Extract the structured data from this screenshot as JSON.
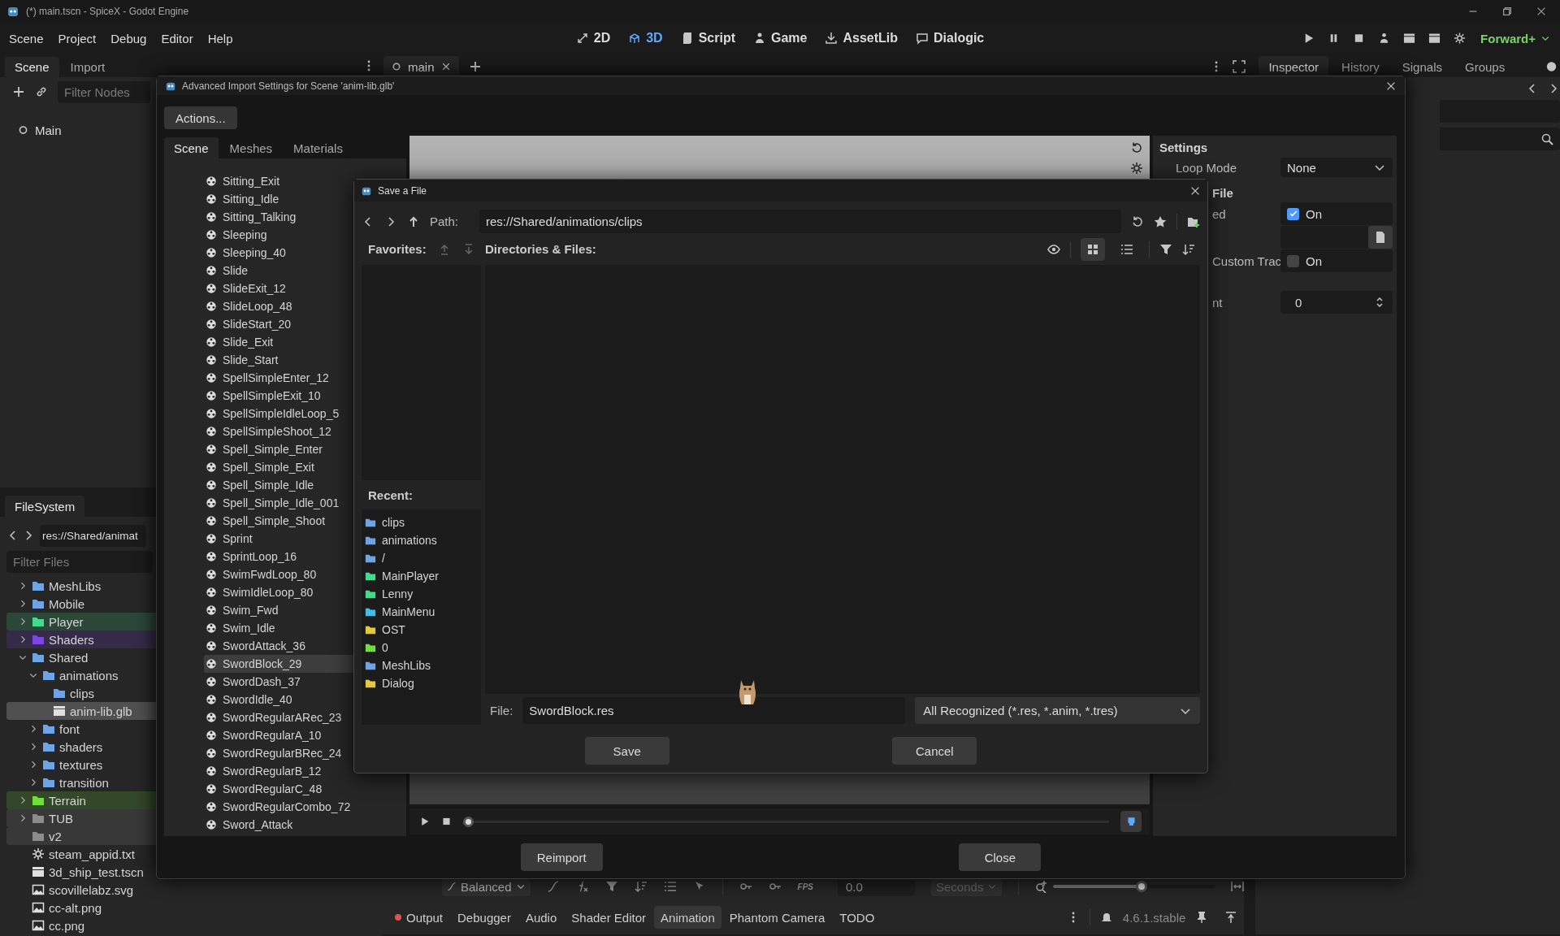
{
  "title_bar": {
    "title": "(*) main.tscn - SpiceX - Godot Engine"
  },
  "menu": [
    "Scene",
    "Project",
    "Debug",
    "Editor",
    "Help"
  ],
  "workspaces": [
    {
      "kind": "twod",
      "label": "2D",
      "selected": false
    },
    {
      "kind": "threed",
      "label": "3D",
      "selected": true
    },
    {
      "kind": "script",
      "label": "Script",
      "selected": false
    },
    {
      "kind": "game",
      "label": "Game",
      "selected": false
    },
    {
      "kind": "assetlib",
      "label": "AssetLib",
      "selected": false
    },
    {
      "kind": "dialogic",
      "label": "Dialogic",
      "selected": false
    }
  ],
  "renderer": "Forward+",
  "scene_dock": {
    "tabs": [
      {
        "label": "Scene",
        "selected": true
      },
      {
        "label": "Import",
        "selected": false
      }
    ],
    "filter_placeholder": "Filter Nodes",
    "nodes": [
      {
        "label": "Main"
      }
    ]
  },
  "filesystem": {
    "tabs": [
      {
        "label": "FileSystem",
        "selected": true
      }
    ],
    "path": "res://Shared/animat",
    "filter_placeholder": "Filter Files",
    "tree": [
      {
        "kind": "folder",
        "label": "MeshLibs",
        "expanded": false,
        "selected": false
      },
      {
        "kind": "folder",
        "label": "Mobile",
        "expanded": false,
        "selected": false
      },
      {
        "kind": "folder",
        "label": "Player",
        "color": "#42dc8c",
        "expanded": false,
        "selected": false
      },
      {
        "kind": "folder",
        "label": "Shaders",
        "color": "#7b45e8",
        "expanded": false,
        "selected": false
      },
      {
        "kind": "folder",
        "label": "Shared",
        "expanded": true,
        "selected": false,
        "children": [
          {
            "kind": "folder",
            "label": "animations",
            "expanded": true,
            "selected": false,
            "children": [
              {
                "kind": "leaf_folder",
                "label": "clips",
                "selected": false
              },
              {
                "kind": "scene",
                "label": "anim-lib.glb",
                "selected": true
              }
            ]
          },
          {
            "kind": "folder",
            "label": "font",
            "expanded": false,
            "selected": false
          },
          {
            "kind": "folder",
            "label": "shaders",
            "expanded": false,
            "selected": false
          },
          {
            "kind": "folder",
            "label": "textures",
            "expanded": false,
            "selected": false
          },
          {
            "kind": "folder",
            "label": "transition",
            "expanded": false,
            "selected": false
          }
        ]
      },
      {
        "kind": "folder",
        "label": "Terrain",
        "color": "#6fe03a",
        "expanded": false,
        "selected": false
      },
      {
        "kind": "folder",
        "label": "TUB",
        "color": "#8c8c8c",
        "expanded": false,
        "selected": false
      },
      {
        "kind": "leaf_folder",
        "label": "v2",
        "color": "#8c8c8c",
        "selected": false
      },
      {
        "kind": "text",
        "label": "steam_appid.txt",
        "selected": false
      },
      {
        "kind": "scene",
        "label": "3d_ship_test.tscn",
        "selected": false
      },
      {
        "kind": "image",
        "label": "scovillelabz.svg",
        "selected": false
      },
      {
        "kind": "image",
        "label": "cc-alt.png",
        "selected": false
      },
      {
        "kind": "image",
        "label": "cc.png",
        "selected": false
      }
    ]
  },
  "scene_tabs": [
    {
      "label": "main",
      "selected": true
    }
  ],
  "inspector_tabs": [
    {
      "label": "Inspector",
      "selected": true
    },
    {
      "label": "History",
      "selected": false
    },
    {
      "label": "Signals",
      "selected": false
    },
    {
      "label": "Groups",
      "selected": false
    }
  ],
  "bottom_panel": {
    "blend": "Balanced",
    "fps_label": "FPS",
    "time": "0.0",
    "unit": {
      "label": "Seconds",
      "disabled": true
    },
    "zoom": {
      "level": 0.55
    },
    "tabs": [
      {
        "label": "Output",
        "selected": false,
        "color": "#e05252"
      },
      {
        "label": "Debugger",
        "selected": false
      },
      {
        "label": "Audio",
        "selected": false
      },
      {
        "label": "Shader Editor",
        "selected": false
      },
      {
        "label": "Animation",
        "selected": true
      },
      {
        "label": "Phantom Camera",
        "selected": false
      },
      {
        "label": "TODO",
        "selected": false
      }
    ],
    "version": "4.6.1.stable"
  },
  "import_dialog": {
    "title": "Advanced Import Settings for Scene 'anim-lib.glb'",
    "actions": "Actions...",
    "tabs": [
      {
        "label": "Scene",
        "selected": true
      },
      {
        "label": "Meshes",
        "selected": false
      },
      {
        "label": "Materials",
        "selected": false
      }
    ],
    "animations": [
      {
        "label": "Sitting_Exit",
        "selected": false
      },
      {
        "label": "Sitting_Idle",
        "selected": false
      },
      {
        "label": "Sitting_Talking",
        "selected": false
      },
      {
        "label": "Sleeping",
        "selected": false
      },
      {
        "label": "Sleeping_40",
        "selected": false
      },
      {
        "label": "Slide",
        "selected": false
      },
      {
        "label": "SlideExit_12",
        "selected": false
      },
      {
        "label": "SlideLoop_48",
        "selected": false
      },
      {
        "label": "SlideStart_20",
        "selected": false
      },
      {
        "label": "Slide_Exit",
        "selected": false
      },
      {
        "label": "Slide_Start",
        "selected": false
      },
      {
        "label": "SpellSimpleEnter_12",
        "selected": false
      },
      {
        "label": "SpellSimpleExit_10",
        "selected": false
      },
      {
        "label": "SpellSimpleIdleLoop_5",
        "selected": false
      },
      {
        "label": "SpellSimpleShoot_12",
        "selected": false
      },
      {
        "label": "Spell_Simple_Enter",
        "selected": false
      },
      {
        "label": "Spell_Simple_Exit",
        "selected": false
      },
      {
        "label": "Spell_Simple_Idle",
        "selected": false
      },
      {
        "label": "Spell_Simple_Idle_001",
        "selected": false
      },
      {
        "label": "Spell_Simple_Shoot",
        "selected": false
      },
      {
        "label": "Sprint",
        "selected": false
      },
      {
        "label": "SprintLoop_16",
        "selected": false
      },
      {
        "label": "SwimFwdLoop_80",
        "selected": false
      },
      {
        "label": "SwimIdleLoop_80",
        "selected": false
      },
      {
        "label": "Swim_Fwd",
        "selected": false
      },
      {
        "label": "Swim_Idle",
        "selected": false
      },
      {
        "label": "SwordAttack_36",
        "selected": false
      },
      {
        "label": "SwordBlock_29",
        "selected": true
      },
      {
        "label": "SwordDash_37",
        "selected": false
      },
      {
        "label": "SwordIdle_40",
        "selected": false
      },
      {
        "label": "SwordRegularARec_23",
        "selected": false
      },
      {
        "label": "SwordRegularA_10",
        "selected": false
      },
      {
        "label": "SwordRegularBRec_24",
        "selected": false
      },
      {
        "label": "SwordRegularB_12",
        "selected": false
      },
      {
        "label": "SwordRegularC_48",
        "selected": false
      },
      {
        "label": "SwordRegularCombo_72",
        "selected": false
      },
      {
        "label": "Sword_Attack",
        "selected": false
      }
    ],
    "timeline": {
      "level": 0
    },
    "settings": [
      {
        "kind": "header",
        "label": "Settings"
      },
      {
        "kind": "dropdown",
        "label": "Loop Mode",
        "value": "None"
      },
      {
        "kind": "header",
        "label": "File"
      },
      {
        "kind": "check",
        "label": "ed",
        "checked": true,
        "value": "On"
      },
      {
        "kind": "file_path"
      },
      {
        "kind": "check",
        "label": "Custom Trac",
        "checked": false,
        "value": "On"
      },
      {
        "kind": "spin",
        "label": "nt",
        "value": "0"
      }
    ],
    "buttons": [
      "Reimport",
      "Close"
    ]
  },
  "save_dialog": {
    "title": "Save a File",
    "path_label": "Path:",
    "path": "res://Shared/animations/clips",
    "favorites_label": "Favorites:",
    "files_label": "Directories & Files:",
    "view_modes": [
      {
        "kind": "grid",
        "selected": true
      },
      {
        "kind": "list",
        "selected": false
      }
    ],
    "recent_label": "Recent:",
    "recent": [
      {
        "label": "clips",
        "color": "#6ea4e6"
      },
      {
        "label": "animations",
        "color": "#6ea4e6"
      },
      {
        "label": "/",
        "color": "#6ea4e6"
      },
      {
        "label": "MainPlayer",
        "color": "#42dc8c"
      },
      {
        "label": "Lenny",
        "color": "#42dc8c"
      },
      {
        "label": "MainMenu",
        "color": "#3cbfe8"
      },
      {
        "label": "OST",
        "color": "#e6c93a"
      },
      {
        "label": "0",
        "color": "#6fe03a"
      },
      {
        "label": "MeshLibs",
        "color": "#6ea4e6"
      },
      {
        "label": "Dialog",
        "color": "#e6c93a"
      }
    ],
    "file_label": "File:",
    "file_name": "SwordBlock.res",
    "filter": "All Recognized (*.res, *.anim, *.tres)",
    "buttons": [
      "Save",
      "Cancel"
    ]
  }
}
